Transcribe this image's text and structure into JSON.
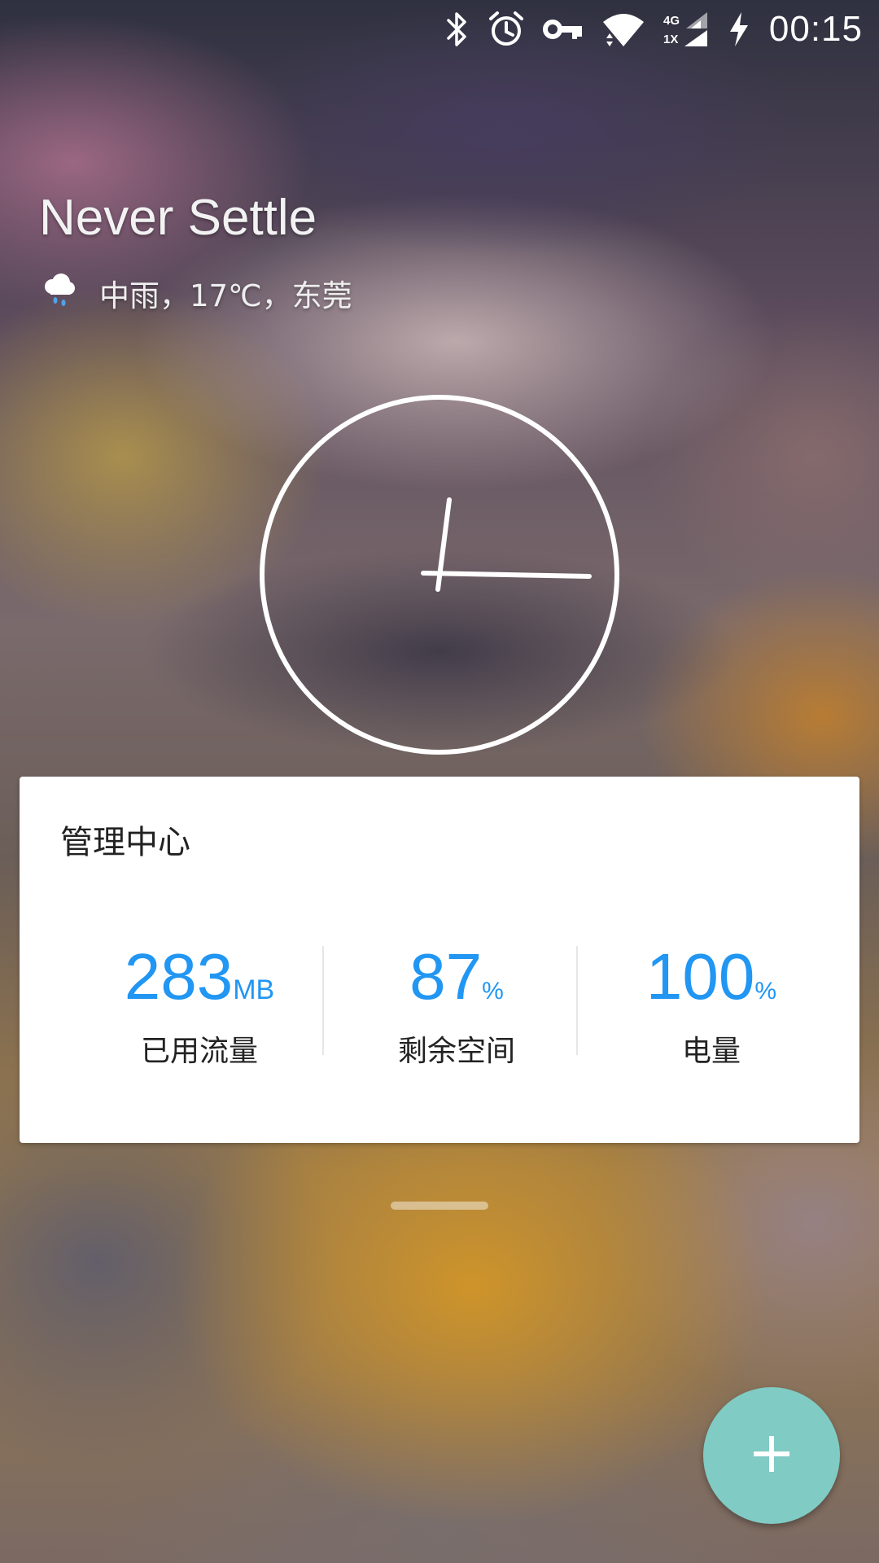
{
  "status_bar": {
    "time": "00:15",
    "icons": [
      "bluetooth-icon",
      "alarm-icon",
      "vpn-key-icon",
      "wifi-icon",
      "signal-4g-1x-icon",
      "charging-icon"
    ],
    "network_top": "4G",
    "network_bottom": "1X"
  },
  "home": {
    "headline": "Never Settle",
    "weather": {
      "icon": "rain-cloud-icon",
      "text": "中雨，17℃，东莞"
    },
    "clock": {
      "hour": 0,
      "minute": 15
    }
  },
  "management_card": {
    "title": "管理中心",
    "stats": [
      {
        "value": "283",
        "unit": "MB",
        "label": "已用流量"
      },
      {
        "value": "87",
        "unit": "%",
        "label": "剩余空间"
      },
      {
        "value": "100",
        "unit": "%",
        "label": "电量"
      }
    ]
  },
  "fab": {
    "icon": "plus-icon",
    "color": "#80cbc4"
  },
  "colors": {
    "accent": "#2196f3",
    "card_bg": "#ffffff"
  }
}
